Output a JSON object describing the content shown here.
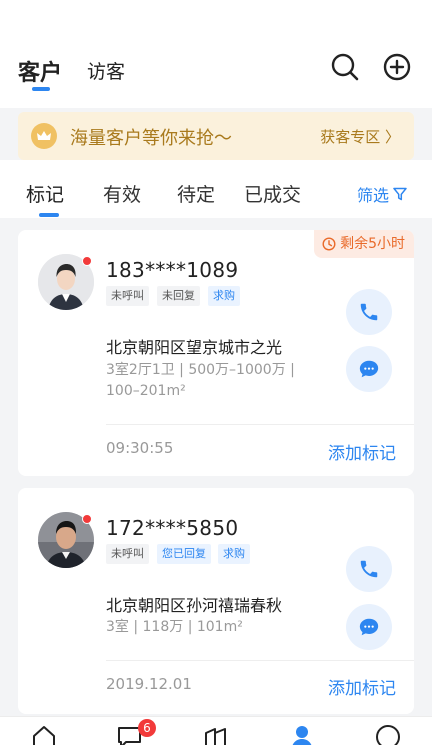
{
  "header": {
    "tabs": [
      {
        "label": "客户",
        "active": true
      },
      {
        "label": "访客",
        "active": false
      }
    ],
    "icons": [
      "search-icon",
      "add-circle-icon"
    ]
  },
  "banner": {
    "icon": "crown-icon",
    "text": "海量客户等你来抢～",
    "link": "获客专区 〉"
  },
  "filter_tabs": [
    {
      "label": "标记",
      "active": true
    },
    {
      "label": "有效"
    },
    {
      "label": "待定"
    },
    {
      "label": "已成交"
    }
  ],
  "filter_button": "筛选",
  "cards": [
    {
      "countdown": "剩余5小时",
      "phone": "183****1089",
      "tags": [
        {
          "text": "未呼叫",
          "style": "gray"
        },
        {
          "text": "未回复",
          "style": "gray"
        },
        {
          "text": "求购",
          "style": "blue"
        }
      ],
      "address": "北京朝阳区望京城市之光",
      "meta_line1": "3室2厅1卫 | 500万–1000万 |",
      "meta_line2": "100–201m²",
      "time": "09:30:55",
      "action": "添加标记"
    },
    {
      "phone": "172****5850",
      "tags": [
        {
          "text": "未呼叫",
          "style": "gray"
        },
        {
          "text": "您已回复",
          "style": "blue"
        },
        {
          "text": "求购",
          "style": "blue"
        }
      ],
      "address": "北京朝阳区孙河禧瑞春秋",
      "meta_line1": "3室 | 118万 | 101m²",
      "time": "2019.12.01",
      "action": "添加标记"
    }
  ],
  "tabbar": {
    "items": [
      "home-icon",
      "message-icon",
      "building-icon",
      "customer-icon",
      "profile-icon"
    ],
    "badge": "6",
    "active_color": "#2d86f0"
  },
  "colors": {
    "accent": "#2d86f0",
    "banner_bg": "#fbf1dc",
    "banner_text": "#a97a1d",
    "countdown": "#e96a2a"
  }
}
